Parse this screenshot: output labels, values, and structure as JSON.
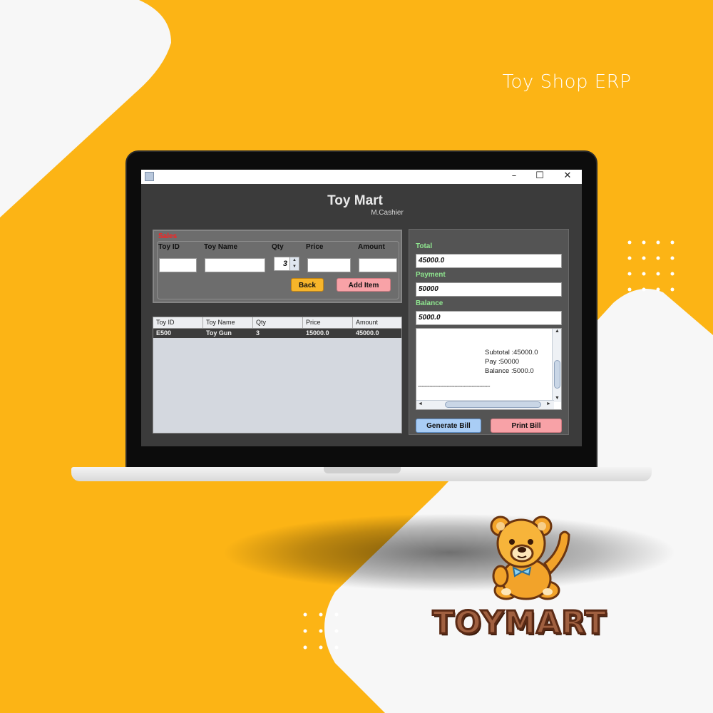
{
  "header": {
    "title": "Toy Shop ERP"
  },
  "window": {
    "controls": {
      "minimize": "–",
      "maximize": "☐",
      "close": "✕"
    }
  },
  "app": {
    "title": "Toy Mart",
    "subtitle": "M.Cashier"
  },
  "sales_form": {
    "section_label": "Sales",
    "fields": [
      {
        "label": "Toy ID",
        "value": ""
      },
      {
        "label": "Toy Name",
        "value": ""
      },
      {
        "label": "Qty",
        "value": "3"
      },
      {
        "label": "Price",
        "value": ""
      },
      {
        "label": "Amount",
        "value": ""
      }
    ],
    "back_label": "Back",
    "add_label": "Add Item"
  },
  "table": {
    "columns": [
      "Toy ID",
      "Toy Name",
      "Qty",
      "Price",
      "Amount"
    ],
    "rows": [
      [
        "E500",
        "Toy Gun",
        "3",
        "15000.0",
        "45000.0"
      ]
    ]
  },
  "billing": {
    "total_label": "Total",
    "total_value": "45000.0",
    "payment_label": "Payment",
    "payment_value": "50000",
    "balance_label": "Balance",
    "balance_value": "5000.0",
    "receipt": {
      "lines": [
        "Subtotal :45000.0",
        "Pay :50000",
        "Balance :5000.0"
      ],
      "separator": "*******************************************************"
    },
    "generate_label": "Generate Bill",
    "print_label": "Print Bill"
  },
  "brand": {
    "logo_text": "TOYMART",
    "mascot": "teddy-bear"
  },
  "colors": {
    "background": "#fcb415",
    "sales_label": "#ff2020",
    "billing_labels": "#8fe68f",
    "back_button": "#f7b52a",
    "add_button": "#f8a2a7",
    "generate_button": "#a9cdf5",
    "print_button": "#f8a2a7"
  }
}
